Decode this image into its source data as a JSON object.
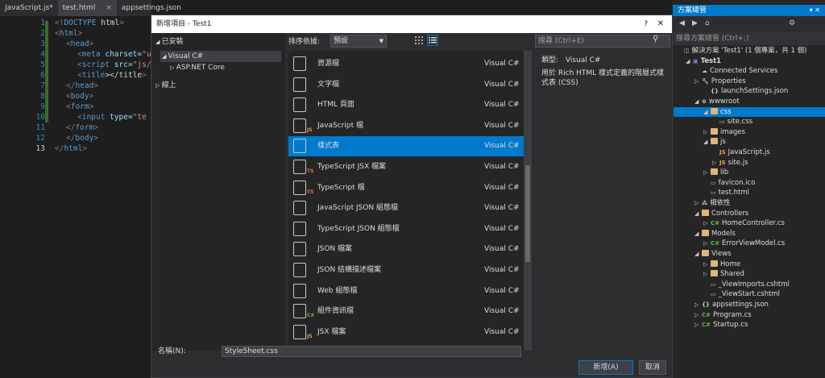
{
  "editor": {
    "tabs": [
      "JavaScript.js*",
      "test.html",
      "appsettings.json"
    ],
    "active_tab_index": 1,
    "tab_close": "×",
    "lines": [
      {
        "n": "1",
        "code": "<!DOCTYPE html>"
      },
      {
        "n": "2",
        "code": "<html>"
      },
      {
        "n": "3",
        "code": "<head>"
      },
      {
        "n": "4",
        "code": "<meta charset=\"u"
      },
      {
        "n": "5",
        "code": "<script src=\"js/"
      },
      {
        "n": "6",
        "code": "<title></title>"
      },
      {
        "n": "7",
        "code": "</head>"
      },
      {
        "n": "8",
        "code": "<body>"
      },
      {
        "n": "9",
        "code": "<form>"
      },
      {
        "n": "10",
        "code": "<input type=\"te"
      },
      {
        "n": "11",
        "code": "</form>"
      },
      {
        "n": "12",
        "code": "</body>"
      },
      {
        "n": "13",
        "code": "</html>"
      }
    ]
  },
  "dialog": {
    "title": "新增項目 - Test1",
    "help": "?",
    "close": "✕",
    "installed": "已安裝",
    "tree": {
      "visual_csharp": "Visual C#",
      "aspnet_core": "ASP.NET Core",
      "online": "線上"
    },
    "sort_label": "排序依據:",
    "sort_value": "預設",
    "search_placeholder": "搜尋 (Ctrl+E)",
    "items": [
      {
        "name": "資源檔",
        "type": "Visual C#",
        "badge": ""
      },
      {
        "name": "文字檔",
        "type": "Visual C#",
        "badge": ""
      },
      {
        "name": "HTML 頁面",
        "type": "Visual C#",
        "badge": ""
      },
      {
        "name": "JavaScript 檔",
        "type": "Visual C#",
        "badge": "JS"
      },
      {
        "name": "樣式表",
        "type": "Visual C#",
        "badge": ""
      },
      {
        "name": "TypeScript JSX 檔案",
        "type": "Visual C#",
        "badge": "TS"
      },
      {
        "name": "TypeScript 檔",
        "type": "Visual C#",
        "badge": "TS"
      },
      {
        "name": "JavaScript JSON 組態檔",
        "type": "Visual C#",
        "badge": ""
      },
      {
        "name": "TypeScript JSON 組態檔",
        "type": "Visual C#",
        "badge": ""
      },
      {
        "name": "JSON 檔案",
        "type": "Visual C#",
        "badge": ""
      },
      {
        "name": "JSON 結構描述檔案",
        "type": "Visual C#",
        "badge": ""
      },
      {
        "name": "Web 組態檔",
        "type": "Visual C#",
        "badge": ""
      },
      {
        "name": "組件資訊檔",
        "type": "Visual C#",
        "badge": "C#"
      },
      {
        "name": "JSX 檔案",
        "type": "Visual C#",
        "badge": "JS"
      }
    ],
    "selected_index": 4,
    "detail": {
      "type_label": "類型:",
      "type_value": "Visual C#",
      "description": "用於 Rich HTML 樣式定義的階層式樣式表 (CSS)"
    },
    "name_label": "名稱(N):",
    "name_value": "StyleSheet.css",
    "add_button": "新增(A)",
    "cancel_button": "取消"
  },
  "solution_explorer": {
    "title": "方案總管",
    "search_placeholder": "搜尋方案總管 (Ctrl+;)",
    "rows": [
      {
        "label": "解決方案 'Test1' (1 個專案，共 1 個)",
        "indent": 0,
        "icon": "solution",
        "arrow": ""
      },
      {
        "label": "Test1",
        "indent": 1,
        "icon": "project",
        "arrow": "◢",
        "bold": true
      },
      {
        "label": "Connected Services",
        "indent": 2,
        "icon": "cloud",
        "arrow": ""
      },
      {
        "label": "Properties",
        "indent": 2,
        "icon": "wrench",
        "arrow": "▷"
      },
      {
        "label": "launchSettings.json",
        "indent": 3,
        "icon": "json",
        "arrow": ""
      },
      {
        "label": "wwwroot",
        "indent": 2,
        "icon": "globe",
        "arrow": "◢"
      },
      {
        "label": "css",
        "indent": 3,
        "icon": "folder",
        "arrow": "◢",
        "selected": true
      },
      {
        "label": "site.css",
        "indent": 4,
        "icon": "file",
        "arrow": ""
      },
      {
        "label": "images",
        "indent": 3,
        "icon": "folder",
        "arrow": "▷"
      },
      {
        "label": "js",
        "indent": 3,
        "icon": "folder",
        "arrow": "◢"
      },
      {
        "label": "JavaScript.js",
        "indent": 4,
        "icon": "js",
        "arrow": ""
      },
      {
        "label": "site.js",
        "indent": 4,
        "icon": "js",
        "arrow": "▷"
      },
      {
        "label": "lib",
        "indent": 3,
        "icon": "folder",
        "arrow": "▷"
      },
      {
        "label": "favicon.ico",
        "indent": 3,
        "icon": "file",
        "arrow": ""
      },
      {
        "label": "test.html",
        "indent": 3,
        "icon": "file",
        "arrow": ""
      },
      {
        "label": "相依性",
        "indent": 2,
        "icon": "deps",
        "arrow": "▷"
      },
      {
        "label": "Controllers",
        "indent": 2,
        "icon": "folder",
        "arrow": "◢"
      },
      {
        "label": "HomeController.cs",
        "indent": 3,
        "icon": "cs",
        "arrow": "▷"
      },
      {
        "label": "Models",
        "indent": 2,
        "icon": "folder",
        "arrow": "◢"
      },
      {
        "label": "ErrorViewModel.cs",
        "indent": 3,
        "icon": "cs",
        "arrow": "▷"
      },
      {
        "label": "Views",
        "indent": 2,
        "icon": "folder",
        "arrow": "◢"
      },
      {
        "label": "Home",
        "indent": 3,
        "icon": "folder",
        "arrow": "▷"
      },
      {
        "label": "Shared",
        "indent": 3,
        "icon": "folder",
        "arrow": "▷"
      },
      {
        "label": "_ViewImports.cshtml",
        "indent": 3,
        "icon": "file",
        "arrow": ""
      },
      {
        "label": "_ViewStart.cshtml",
        "indent": 3,
        "icon": "file",
        "arrow": ""
      },
      {
        "label": "appsettings.json",
        "indent": 2,
        "icon": "json",
        "arrow": "▷"
      },
      {
        "label": "Program.cs",
        "indent": 2,
        "icon": "cs",
        "arrow": "▷"
      },
      {
        "label": "Startup.cs",
        "indent": 2,
        "icon": "cs",
        "arrow": "▷"
      }
    ]
  },
  "colors": {
    "accent": "#007acc",
    "bg": "#1e1e1e",
    "panel": "#252526"
  }
}
